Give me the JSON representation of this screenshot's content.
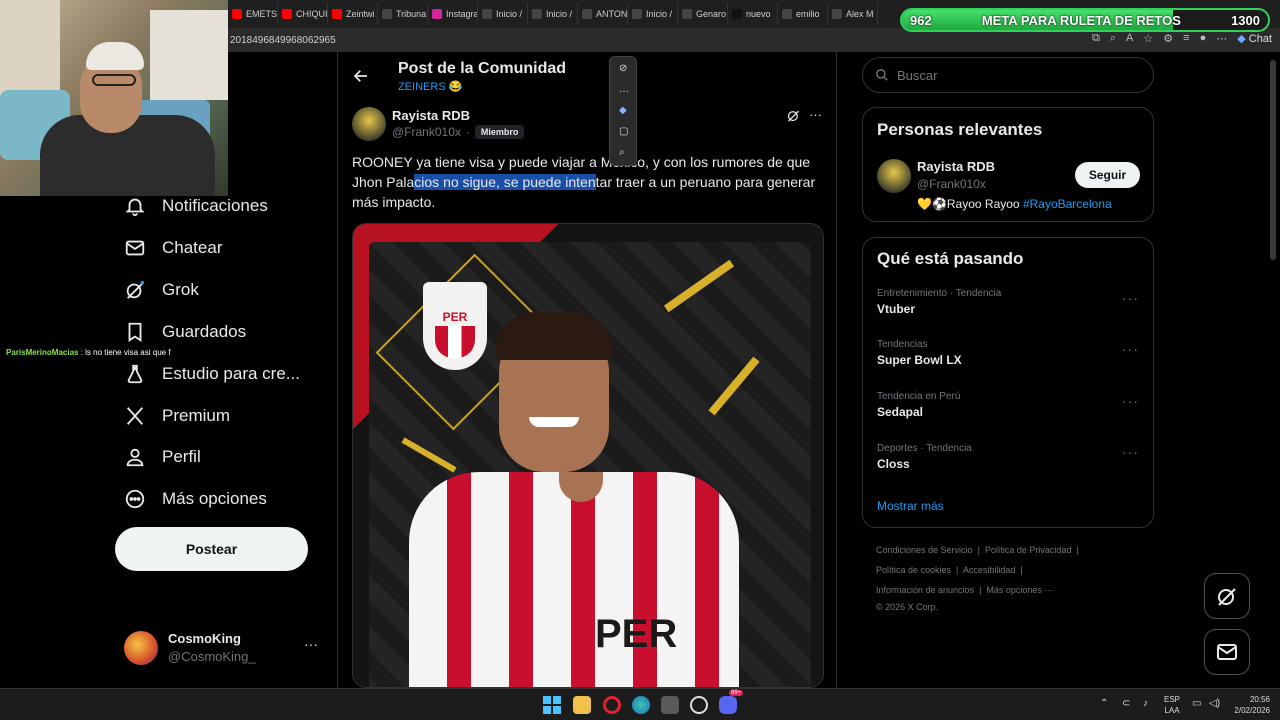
{
  "browser": {
    "tabs": [
      {
        "label": "EMETSU",
        "icon": "youtube-icon",
        "color": "#ff0000"
      },
      {
        "label": "CHIQUI",
        "icon": "youtube-icon",
        "color": "#ff0000"
      },
      {
        "label": "Zeintwi",
        "icon": "youtube-icon",
        "color": "#ff0000"
      },
      {
        "label": "Tribuna",
        "icon": "x-icon",
        "color": "#444444"
      },
      {
        "label": "Instagra",
        "icon": "instagram-icon",
        "color": "#d6249f"
      },
      {
        "label": "Inicio /",
        "icon": "x-icon",
        "color": "#444444"
      },
      {
        "label": "Inicio /",
        "icon": "x-icon",
        "color": "#444444"
      },
      {
        "label": "ANTON",
        "icon": "x-icon",
        "color": "#444444"
      },
      {
        "label": "Inicio /",
        "icon": "x-icon",
        "color": "#444444"
      },
      {
        "label": "Genaro",
        "icon": "x-icon",
        "color": "#444444"
      },
      {
        "label": "nuevo",
        "icon": "tiktok-icon",
        "color": "#111111"
      },
      {
        "label": "emilio",
        "icon": "x-icon",
        "color": "#444444"
      },
      {
        "label": "Alex M",
        "icon": "x-icon",
        "color": "#444444"
      }
    ],
    "url": "2018496849968062965",
    "chat_label": "Chat"
  },
  "goal_bar": {
    "current": "962",
    "title": "META PARA RULETA DE RETOS",
    "target": "1300",
    "progress": 0.74
  },
  "stream_chat": {
    "user": "ParisMerinoMacias",
    "message": " : ls no tiene visa asi que f"
  },
  "nav": {
    "items": [
      {
        "label": "Notificaciones",
        "icon": "bell-icon"
      },
      {
        "label": "Chatear",
        "icon": "envelope-icon"
      },
      {
        "label": "Grok",
        "icon": "grok-icon"
      },
      {
        "label": "Guardados",
        "icon": "bookmark-icon"
      },
      {
        "label": "Estudio para cre...",
        "icon": "flask-icon"
      },
      {
        "label": "Premium",
        "icon": "x-logo-icon"
      },
      {
        "label": "Perfil",
        "icon": "person-icon"
      },
      {
        "label": "Más opciones",
        "icon": "more-circle-icon"
      }
    ],
    "post_button": "Postear",
    "account": {
      "name": "CosmoKing",
      "handle": "@CosmoKing_"
    }
  },
  "post": {
    "header_title": "Post de la Comunidad",
    "community": "ZEINERS 😂",
    "author_name": "Rayista RDB",
    "author_handle": "@Frank010x",
    "separator": "·",
    "member_badge": "Miembro",
    "text_before": "ROONEY ya tiene visa y puede viajar a México, y con los rumores de que Jhon Pala",
    "text_highlight": "cios no sigue, se puede inten",
    "text_after": "tar traer a un peruano para generar más impacto.",
    "card_logo_text": "PER",
    "jersey_text": "PER"
  },
  "floating_toolbar": {
    "icons": [
      "eye-off-icon",
      "more-icon",
      "copilot-icon",
      "copy-icon",
      "search-icon"
    ]
  },
  "sidebar": {
    "search_placeholder": "Buscar",
    "relevant_title": "Personas relevantes",
    "relevant_person": {
      "name": "Rayista RDB",
      "handle": "@Frank010x",
      "follow_label": "Seguir",
      "bio_text": "💛⚽Rayoo Rayoo ",
      "bio_hashtag": "#RayoBarcelona"
    },
    "trends_title": "Qué está pasando",
    "trends": [
      {
        "meta": "Entretenimiento · Tendencia",
        "name": "Vtuber"
      },
      {
        "meta": "Tendencias",
        "name": "Super Bowl LX"
      },
      {
        "meta": "Tendencia en Perú",
        "name": "Sedapal"
      },
      {
        "meta": "Deportes · Tendencia",
        "name": "Closs"
      }
    ],
    "show_more": "Mostrar más",
    "footer_links": [
      [
        "Condiciones de Servicio",
        "Política de Privacidad"
      ],
      [
        "Política de cookies",
        "Accesibilidad"
      ],
      [
        "Información de anuncios",
        "Más opciones ···"
      ]
    ],
    "copyright": "© 2026 X Corp."
  },
  "taskbar": {
    "lang_top": "ESP",
    "lang_bottom": "LAA",
    "time": "20:56",
    "date": "2/02/2026",
    "notification_badge": "99+"
  }
}
